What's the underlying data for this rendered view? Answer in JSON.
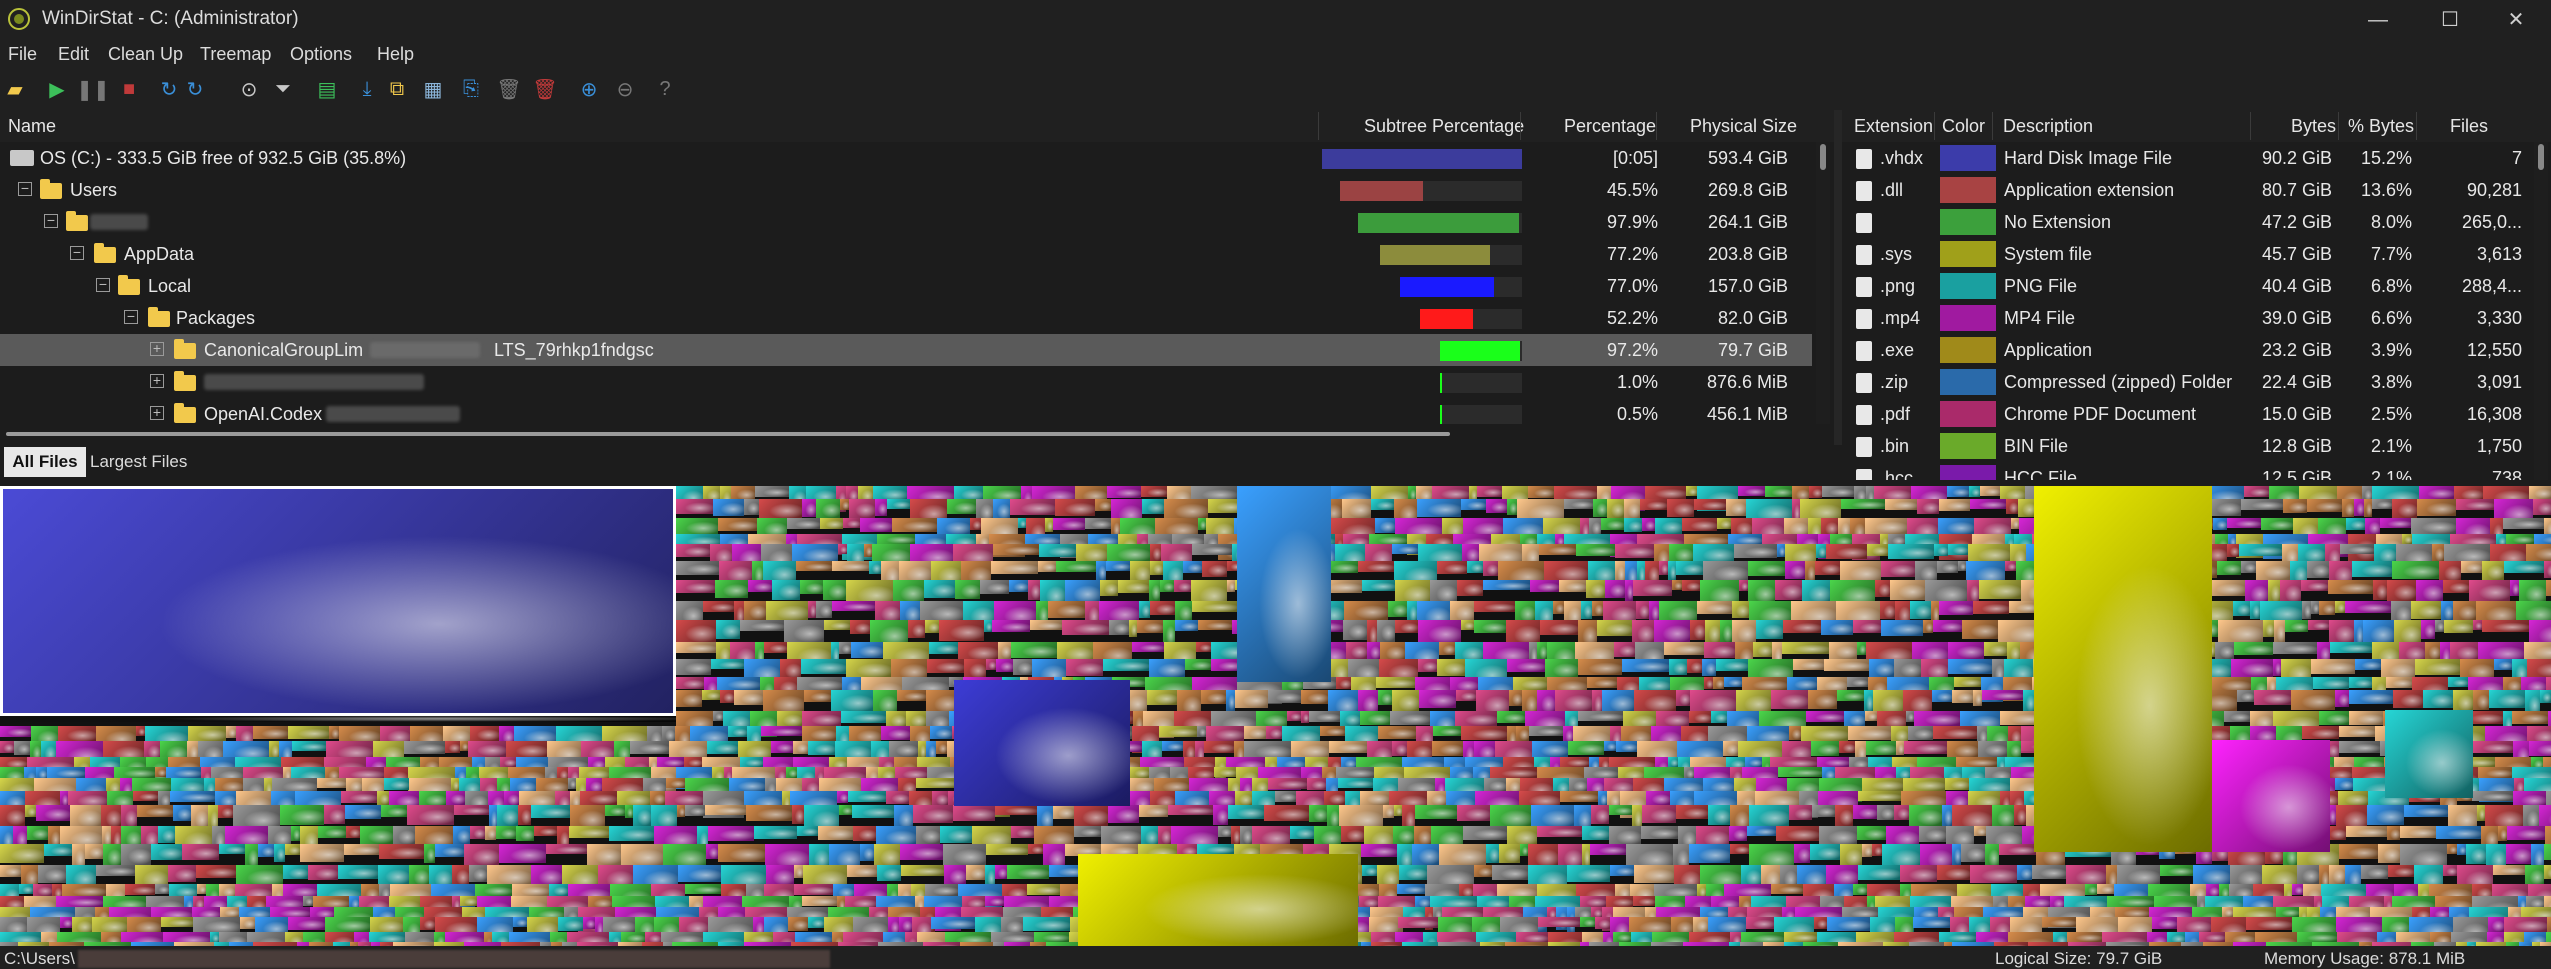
{
  "window": {
    "title": "WinDirStat - C:  (Administrator)",
    "controls": [
      "—",
      "☐",
      "✕"
    ]
  },
  "menu": [
    "File",
    "Edit",
    "Clean Up",
    "Treemap",
    "Options",
    "Help"
  ],
  "tree": {
    "columns": [
      "Name",
      "Subtree Percentage",
      "Percentage",
      "Physical Size"
    ],
    "rows": [
      {
        "name": "OS (C:) - 333.5 GiB free of 932.5 GiB (35.8%)",
        "pct": "[0:05]",
        "size": "593.4 GiB",
        "bar_fraction": 1.0,
        "bar_color": "#3c3c9c"
      },
      {
        "name": "Users",
        "pct": "45.5%",
        "size": "269.8 GiB",
        "bar_fraction": 0.455,
        "bar_color": "#9b4343"
      },
      {
        "name": "",
        "pct": "97.9%",
        "size": "264.1 GiB",
        "bar_fraction": 0.979,
        "bar_color": "#3c9c3c"
      },
      {
        "name": "AppData",
        "pct": "77.2%",
        "size": "203.8 GiB",
        "bar_fraction": 0.772,
        "bar_color": "#8c8c3c"
      },
      {
        "name": "Local",
        "pct": "77.0%",
        "size": "157.0 GiB",
        "bar_fraction": 0.77,
        "bar_color": "#1a1aff"
      },
      {
        "name": "Packages",
        "pct": "52.2%",
        "size": "82.0 GiB",
        "bar_fraction": 0.522,
        "bar_color": "#ff1a1a"
      },
      {
        "name": "CanonicalGroupLim",
        "name_suffix": "LTS_79rhkp1fndgsc",
        "pct": "97.2%",
        "size": "79.7 GiB",
        "bar_fraction": 0.972,
        "bar_color": "#1aff1a",
        "selected": true
      },
      {
        "name": "",
        "pct": "1.0%",
        "size": "876.6 MiB",
        "bar_fraction": 0.01,
        "bar_color": "#1aff1a"
      },
      {
        "name": "OpenAI.Codex",
        "pct": "0.5%",
        "size": "456.1 MiB",
        "bar_fraction": 0.005,
        "bar_color": "#1aff1a"
      }
    ]
  },
  "extensions": {
    "columns": [
      "Extension",
      "Color",
      "Description",
      "Bytes",
      "% Bytes",
      "Files"
    ],
    "rows": [
      {
        "ext": ".vhdx",
        "color": "#3c3caa",
        "desc": "Hard Disk Image File",
        "bytes": "90.2 GiB",
        "pct": "15.2%",
        "files": "7"
      },
      {
        "ext": ".dll",
        "color": "#a84343",
        "desc": "Application extension",
        "bytes": "80.7 GiB",
        "pct": "13.6%",
        "files": "90,281"
      },
      {
        "ext": "",
        "color": "#3ca03c",
        "desc": "No Extension",
        "bytes": "47.2 GiB",
        "pct": "8.0%",
        "files": "265,0..."
      },
      {
        "ext": ".sys",
        "color": "#a0a01a",
        "desc": "System file",
        "bytes": "45.7 GiB",
        "pct": "7.7%",
        "files": "3,613"
      },
      {
        "ext": ".png",
        "color": "#1aa0a0",
        "desc": "PNG File",
        "bytes": "40.4 GiB",
        "pct": "6.8%",
        "files": "288,4..."
      },
      {
        "ext": ".mp4",
        "color": "#a01aa0",
        "desc": "MP4 File",
        "bytes": "39.0 GiB",
        "pct": "6.6%",
        "files": "3,330"
      },
      {
        "ext": ".exe",
        "color": "#a08a1a",
        "desc": "Application",
        "bytes": "23.2 GiB",
        "pct": "3.9%",
        "files": "12,550"
      },
      {
        "ext": ".zip",
        "color": "#2a6aaa",
        "desc": "Compressed (zipped) Folder",
        "bytes": "22.4 GiB",
        "pct": "3.8%",
        "files": "3,091"
      },
      {
        "ext": ".pdf",
        "color": "#aa2a6a",
        "desc": "Chrome PDF Document",
        "bytes": "15.0 GiB",
        "pct": "2.5%",
        "files": "16,308"
      },
      {
        "ext": ".bin",
        "color": "#6aaa2a",
        "desc": "BIN File",
        "bytes": "12.8 GiB",
        "pct": "2.1%",
        "files": "1,750"
      },
      {
        "ext": ".hcc",
        "color": "#7a1aaa",
        "desc": "HCC File",
        "bytes": "12.5 GiB",
        "pct": "2.1%",
        "files": "738"
      }
    ]
  },
  "tabs": [
    "All Files",
    "Largest Files"
  ],
  "status": {
    "path": "C:\\Users\\",
    "logical": "Logical Size: 79.7 GiB",
    "memory": "Memory Usage: 878.1 MiB"
  }
}
